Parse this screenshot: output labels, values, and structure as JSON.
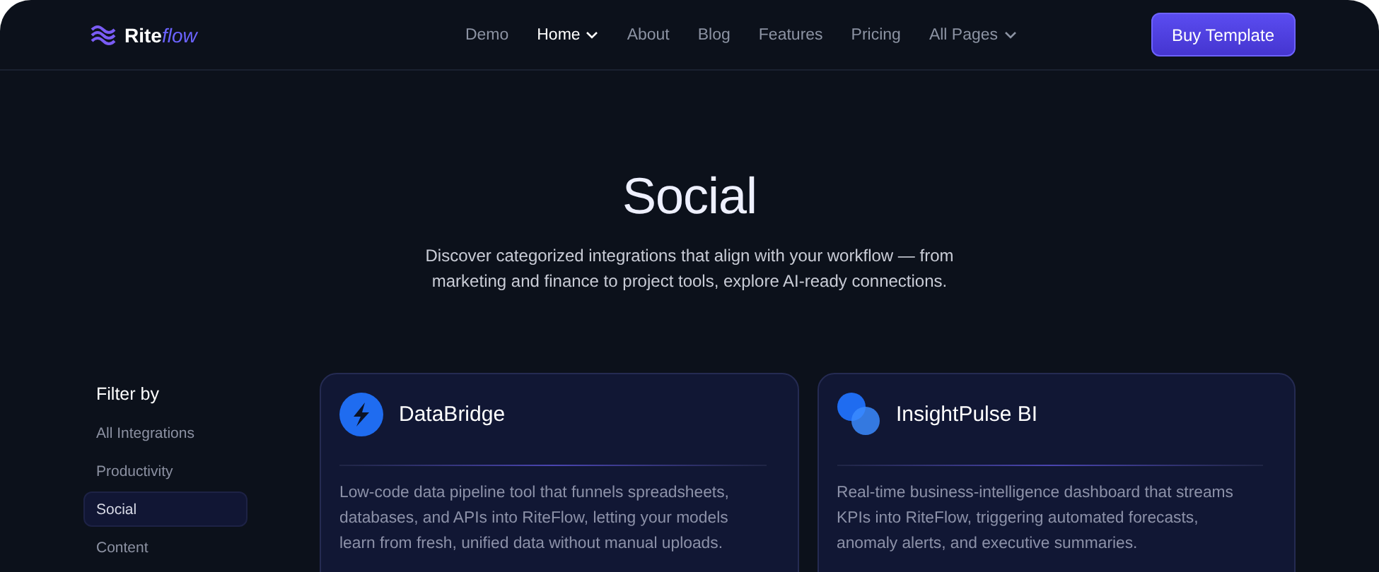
{
  "header": {
    "logo": {
      "name": "Rite",
      "accent": "flow"
    },
    "nav": [
      {
        "label": "Demo",
        "selected": false,
        "dropdown": false
      },
      {
        "label": "Home",
        "selected": true,
        "dropdown": true
      },
      {
        "label": "About",
        "selected": false,
        "dropdown": false
      },
      {
        "label": "Blog",
        "selected": false,
        "dropdown": false
      },
      {
        "label": "Features",
        "selected": false,
        "dropdown": false
      },
      {
        "label": "Pricing",
        "selected": false,
        "dropdown": false
      },
      {
        "label": "All Pages",
        "selected": false,
        "dropdown": true
      }
    ],
    "cta": "Buy Template"
  },
  "hero": {
    "title": "Social",
    "subtitle": "Discover categorized integrations that align with your workflow — from marketing and finance to project tools, explore AI-ready connections."
  },
  "filter": {
    "heading": "Filter by",
    "items": [
      {
        "label": "All Integrations",
        "selected": false
      },
      {
        "label": "Productivity",
        "selected": false
      },
      {
        "label": "Social",
        "selected": true
      },
      {
        "label": "Content",
        "selected": false
      }
    ]
  },
  "cards": [
    {
      "kind": "bolt",
      "name": "DataBridge",
      "description": "Low-code data pipeline tool that funnels spreadsheets, databases, and APIs into RiteFlow, letting your models learn from fresh, unified data without manual uploads."
    },
    {
      "kind": "circles",
      "name": "InsightPulse BI",
      "description": "Real-time business-intelligence dashboard that streams KPIs into RiteFlow, triggering automated forecasts, anomaly alerts, and executive summaries."
    }
  ]
}
